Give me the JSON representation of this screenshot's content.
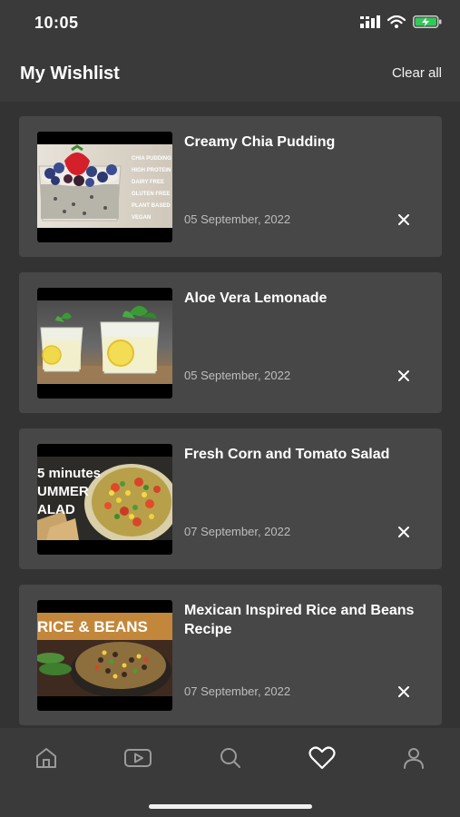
{
  "status_bar": {
    "time": "10:05"
  },
  "header": {
    "title": "My Wishlist",
    "clear_all_label": "Clear all"
  },
  "wishlist": [
    {
      "title": "Creamy Chia Pudding",
      "date": "05 September, 2022",
      "thumbnail_text": [
        "CHIA PUDDING",
        "HIGH PROTEIN",
        "DAIRY FREE",
        "GLUTEN FREE",
        "PLANT BASED",
        "VEGAN"
      ]
    },
    {
      "title": "Aloe Vera Lemonade",
      "date": "05 September, 2022"
    },
    {
      "title": "Fresh Corn and Tomato Salad",
      "date": "07 September, 2022",
      "thumbnail_text": [
        "5 minutes",
        "UMMER",
        "ALAD"
      ]
    },
    {
      "title": "Mexican Inspired Rice and Beans Recipe",
      "date": "07 September, 2022",
      "thumbnail_text": [
        "RICE & BEANS"
      ]
    }
  ],
  "tab_bar": {
    "tabs": [
      {
        "icon": "home-icon",
        "active": false
      },
      {
        "icon": "video-play-icon",
        "active": false
      },
      {
        "icon": "search-icon",
        "active": false
      },
      {
        "icon": "heart-icon",
        "active": true
      },
      {
        "icon": "profile-icon",
        "active": false
      }
    ]
  },
  "colors": {
    "background": "#333333",
    "card": "#474747",
    "bar": "#3a3a3a",
    "battery": "#34c759"
  }
}
